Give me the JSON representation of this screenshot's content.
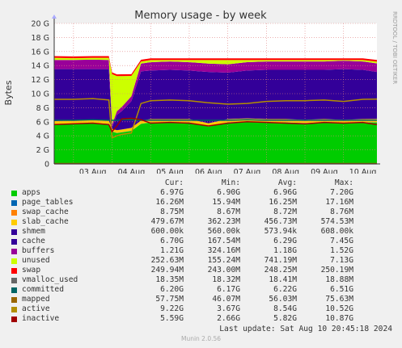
{
  "chart_data": {
    "type": "area",
    "title": "Memory usage - by week",
    "ylabel": "Bytes",
    "side_text": "RRDTOOL / TOBI OETIKER",
    "ylim": [
      0,
      20
    ],
    "y_unit": "G",
    "y_ticks": [
      "0",
      "2 G",
      "4 G",
      "6 G",
      "8 G",
      "10 G",
      "12 G",
      "14 G",
      "16 G",
      "18 G",
      "20 G"
    ],
    "x_range": [
      "2024-08-02T12:00",
      "2024-08-10T20:45"
    ],
    "x_ticks": [
      {
        "date": "2024-08-03",
        "label": "03 Aug"
      },
      {
        "date": "2024-08-04",
        "label": "04 Aug"
      },
      {
        "date": "2024-08-05",
        "label": "05 Aug"
      },
      {
        "date": "2024-08-06",
        "label": "06 Aug"
      },
      {
        "date": "2024-08-07",
        "label": "07 Aug"
      },
      {
        "date": "2024-08-08",
        "label": "08 Aug"
      },
      {
        "date": "2024-08-09",
        "label": "09 Aug"
      },
      {
        "date": "2024-08-10",
        "label": "10 Aug"
      }
    ],
    "grid": true,
    "x": [
      "2024-08-02T12:00",
      "2024-08-03T00:00",
      "2024-08-03T12:00",
      "2024-08-03T22:00",
      "2024-08-04T00:00",
      "2024-08-04T03:00",
      "2024-08-04T06:00",
      "2024-08-04T12:00",
      "2024-08-04T18:00",
      "2024-08-05T00:00",
      "2024-08-05T12:00",
      "2024-08-06T00:00",
      "2024-08-06T12:00",
      "2024-08-07T00:00",
      "2024-08-07T12:00",
      "2024-08-08T00:00",
      "2024-08-08T12:00",
      "2024-08-09T00:00",
      "2024-08-09T12:00",
      "2024-08-10T00:00",
      "2024-08-10T12:00",
      "2024-08-10T20:45"
    ],
    "stack": [
      {
        "name": "apps",
        "color": "#00cc00",
        "values": [
          5.6,
          5.7,
          5.8,
          5.7,
          4.6,
          4.4,
          4.5,
          4.7,
          5.7,
          5.9,
          5.9,
          5.9,
          5.3,
          5.9,
          6.0,
          5.9,
          5.9,
          5.8,
          5.9,
          5.8,
          5.9,
          5.9
        ]
      },
      {
        "name": "page_tables",
        "color": "#0066b3",
        "values": [
          0.016,
          0.016,
          0.016,
          0.016,
          0.016,
          0.016,
          0.016,
          0.016,
          0.016,
          0.016,
          0.016,
          0.016,
          0.016,
          0.016,
          0.016,
          0.016,
          0.016,
          0.016,
          0.016,
          0.016,
          0.016,
          0.016
        ]
      },
      {
        "name": "swap_cache",
        "color": "#ff8000",
        "values": [
          0.009,
          0.009,
          0.009,
          0.009,
          0.009,
          0.009,
          0.009,
          0.009,
          0.009,
          0.009,
          0.009,
          0.009,
          0.009,
          0.009,
          0.009,
          0.009,
          0.009,
          0.009,
          0.009,
          0.009,
          0.009,
          0.009
        ]
      },
      {
        "name": "slab_cache",
        "color": "#ffcc00",
        "values": [
          0.47,
          0.47,
          0.47,
          0.47,
          0.36,
          0.37,
          0.38,
          0.4,
          0.45,
          0.46,
          0.46,
          0.46,
          0.46,
          0.46,
          0.46,
          0.46,
          0.46,
          0.46,
          0.46,
          0.46,
          0.46,
          0.47
        ]
      },
      {
        "name": "shmem",
        "color": "#330099",
        "values": [
          0.0006,
          0.0006,
          0.0006,
          0.0006,
          0.0006,
          0.0006,
          0.0006,
          0.0006,
          0.0006,
          0.0006,
          0.0006,
          0.0006,
          0.0006,
          0.0006,
          0.0006,
          0.0006,
          0.0006,
          0.0006,
          0.0006,
          0.0006,
          0.0006,
          0.0006
        ]
      },
      {
        "name": "cache",
        "color": "#330099",
        "values": [
          7.4,
          7.3,
          7.2,
          7.3,
          0.2,
          2.2,
          2.6,
          3.8,
          7.0,
          6.9,
          7.0,
          6.9,
          7.3,
          6.6,
          6.8,
          7.0,
          7.0,
          7.1,
          7.0,
          7.2,
          7.0,
          6.7
        ]
      },
      {
        "name": "buffers",
        "color": "#990099",
        "values": [
          1.3,
          1.3,
          1.35,
          1.3,
          0.4,
          0.5,
          0.6,
          0.7,
          1.1,
          1.2,
          1.2,
          1.2,
          1.2,
          1.2,
          1.2,
          1.2,
          1.2,
          1.2,
          1.2,
          1.2,
          1.2,
          1.21
        ]
      },
      {
        "name": "unused",
        "color": "#ccff00",
        "values": [
          0.3,
          0.25,
          0.25,
          0.3,
          7.2,
          5.0,
          4.4,
          2.9,
          0.3,
          0.3,
          0.2,
          0.3,
          0.5,
          0.6,
          0.3,
          0.2,
          0.2,
          0.2,
          0.2,
          0.1,
          0.2,
          0.25
        ]
      },
      {
        "name": "swap",
        "color": "#ff0000",
        "values": [
          0.25,
          0.25,
          0.25,
          0.25,
          0.25,
          0.25,
          0.25,
          0.25,
          0.25,
          0.25,
          0.25,
          0.25,
          0.25,
          0.25,
          0.25,
          0.25,
          0.25,
          0.25,
          0.25,
          0.25,
          0.25,
          0.25
        ]
      }
    ],
    "lines": [
      {
        "name": "vmalloc_used",
        "color": "#666666",
        "values": [
          0.018,
          0.018,
          0.018,
          0.018,
          0.018,
          0.018,
          0.018,
          0.018,
          0.018,
          0.018,
          0.018,
          0.018,
          0.018,
          0.018,
          0.018,
          0.018,
          0.018,
          0.018,
          0.018,
          0.018,
          0.018,
          0.018
        ]
      },
      {
        "name": "committed",
        "color": "#006666",
        "values": [
          6.2,
          6.2,
          6.3,
          6.2,
          6.2,
          6.2,
          6.3,
          6.3,
          6.2,
          6.2,
          6.2,
          6.2,
          6.2,
          6.2,
          6.3,
          6.2,
          6.2,
          6.2,
          6.2,
          6.2,
          6.2,
          6.2
        ]
      },
      {
        "name": "mapped",
        "color": "#996600",
        "values": [
          0.058,
          0.058,
          0.058,
          0.058,
          0.058,
          0.058,
          0.058,
          0.058,
          0.058,
          0.058,
          0.058,
          0.058,
          0.058,
          0.058,
          0.058,
          0.058,
          0.058,
          0.058,
          0.058,
          0.058,
          0.058,
          0.058
        ]
      },
      {
        "name": "active",
        "color": "#b38f00",
        "values": [
          9.2,
          9.2,
          9.3,
          9.1,
          3.7,
          4.0,
          4.2,
          4.4,
          8.6,
          9.0,
          9.1,
          9.0,
          8.7,
          8.5,
          8.6,
          8.9,
          9.0,
          9.0,
          9.1,
          8.9,
          9.2,
          9.22
        ]
      },
      {
        "name": "inactive",
        "color": "#a00000",
        "values": [
          5.6,
          5.7,
          5.8,
          5.6,
          4.6,
          5.4,
          6.4,
          6.5,
          6.3,
          5.8,
          5.9,
          5.8,
          5.4,
          5.8,
          6.0,
          5.9,
          5.8,
          5.7,
          5.9,
          5.8,
          5.9,
          5.59
        ]
      }
    ],
    "legend": {
      "headers": [
        "Cur:",
        "Min:",
        "Avg:",
        "Max:"
      ],
      "rows": [
        {
          "name": "apps",
          "color": "#00cc00",
          "cur": "6.97G",
          "min": "6.90G",
          "avg": "6.96G",
          "max": "7.20G"
        },
        {
          "name": "page_tables",
          "color": "#0066b3",
          "cur": "16.26M",
          "min": "15.94M",
          "avg": "16.25M",
          "max": "17.16M"
        },
        {
          "name": "swap_cache",
          "color": "#ff8000",
          "cur": "8.75M",
          "min": "8.67M",
          "avg": "8.72M",
          "max": "8.76M"
        },
        {
          "name": "slab_cache",
          "color": "#ffcc00",
          "cur": "479.67M",
          "min": "362.23M",
          "avg": "456.73M",
          "max": "574.53M"
        },
        {
          "name": "shmem",
          "color": "#330099",
          "cur": "600.00k",
          "min": "560.00k",
          "avg": "573.94k",
          "max": "608.00k"
        },
        {
          "name": "cache",
          "color": "#330099",
          "cur": "6.70G",
          "min": "167.54M",
          "avg": "6.29G",
          "max": "7.45G"
        },
        {
          "name": "buffers",
          "color": "#990099",
          "cur": "1.21G",
          "min": "324.16M",
          "avg": "1.18G",
          "max": "1.52G"
        },
        {
          "name": "unused",
          "color": "#ccff00",
          "cur": "252.63M",
          "min": "155.24M",
          "avg": "741.19M",
          "max": "7.13G"
        },
        {
          "name": "swap",
          "color": "#ff0000",
          "cur": "249.94M",
          "min": "243.00M",
          "avg": "248.25M",
          "max": "250.19M"
        },
        {
          "name": "vmalloc_used",
          "color": "#666666",
          "cur": "18.35M",
          "min": "18.32M",
          "avg": "18.41M",
          "max": "18.88M"
        },
        {
          "name": "committed",
          "color": "#006666",
          "cur": "6.20G",
          "min": "6.17G",
          "avg": "6.22G",
          "max": "6.51G"
        },
        {
          "name": "mapped",
          "color": "#996600",
          "cur": "57.75M",
          "min": "46.07M",
          "avg": "56.03M",
          "max": "75.63M"
        },
        {
          "name": "active",
          "color": "#b38f00",
          "cur": "9.22G",
          "min": "3.67G",
          "avg": "8.54G",
          "max": "10.52G"
        },
        {
          "name": "inactive",
          "color": "#a00000",
          "cur": "5.59G",
          "min": "2.66G",
          "avg": "5.82G",
          "max": "10.87G"
        }
      ]
    }
  },
  "last_update": "Last update: Sat Aug 10 20:45:18 2024",
  "footer": "Munin 2.0.56"
}
